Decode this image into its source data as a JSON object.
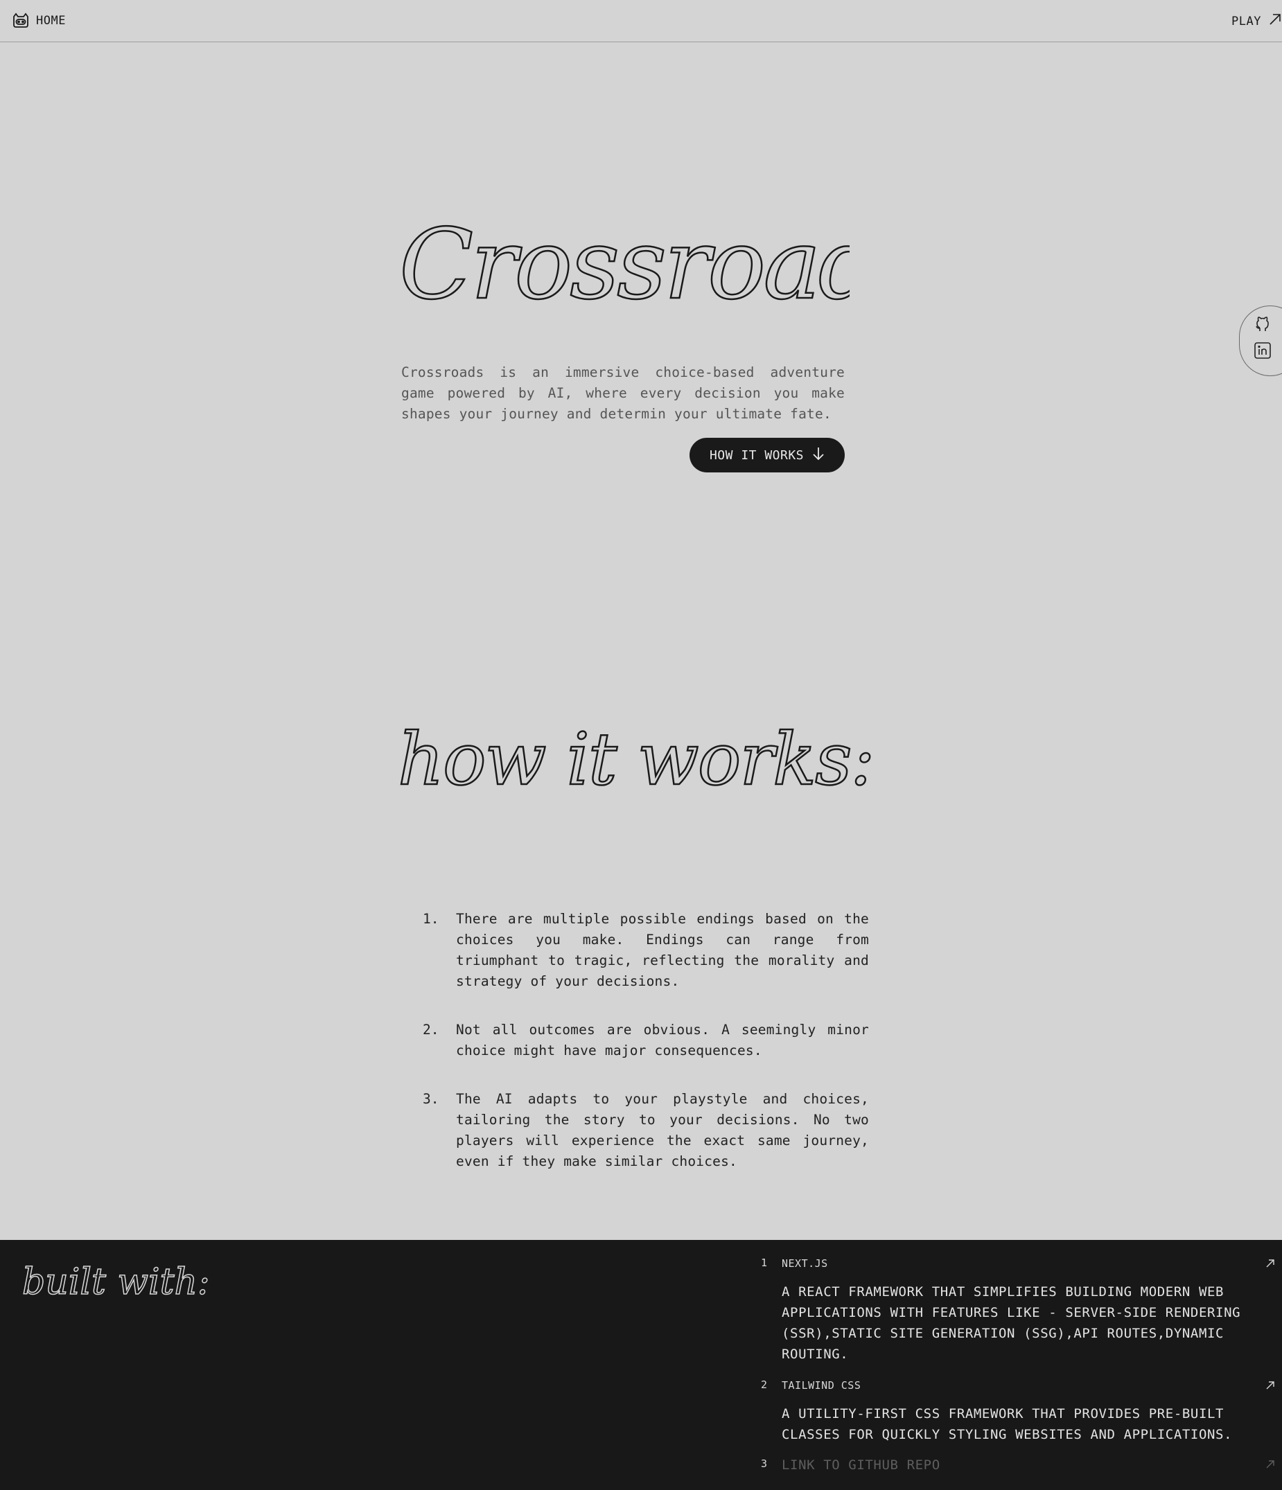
{
  "nav": {
    "home_label": "HOME",
    "play_label": "PLAY",
    "home_icon": "game-controller-icon",
    "play_icon": "arrow-up-right-icon"
  },
  "social": {
    "icons": [
      "github-icon",
      "linkedin-icon"
    ]
  },
  "hero": {
    "title": "Crossroads",
    "description": "Crossroads is an immersive choice-based adventure game powered by AI, where every decision you make shapes your journey and determin your ultimate fate.",
    "button_label": "HOW IT WORKS",
    "button_icon": "arrow-down-icon"
  },
  "how_it_works": {
    "title": "how it works:",
    "steps": [
      {
        "num": "1.",
        "text": "There are multiple possible endings based on the choices you make. Endings can range from triumphant to tragic, reflecting the morality and strategy of your decisions."
      },
      {
        "num": "2.",
        "text": "Not all outcomes are obvious. A seemingly minor choice might have major consequences."
      },
      {
        "num": "3.",
        "text": "The AI adapts to your playstyle and choices, tailoring the story to your decisions. No two players will experience the exact same journey, even if they make similar choices."
      }
    ]
  },
  "built_with": {
    "title": "built with:",
    "items": [
      {
        "num": "1",
        "name": "NEXT.JS",
        "description": "A REACT FRAMEWORK THAT SIMPLIFIES BUILDING MODERN WEB APPLICATIONS WITH FEATURES LIKE - SERVER-SIDE RENDERING (SSR),STATIC SITE GENERATION (SSG),API ROUTES,DYNAMIC ROUTING."
      },
      {
        "num": "2",
        "name": "TAILWIND CSS",
        "description": "A UTILITY-FIRST CSS FRAMEWORK THAT PROVIDES PRE-BUILT CLASSES FOR QUICKLY STYLING WEBSITES AND APPLICATIONS."
      },
      {
        "num": "3",
        "name": "LINK TO GITHUB REPO",
        "description": ""
      }
    ]
  },
  "colors": {
    "background": "#d4d4d4",
    "footer_background": "#181818",
    "button_background": "#1a1a1a",
    "muted_text": "#555555"
  }
}
